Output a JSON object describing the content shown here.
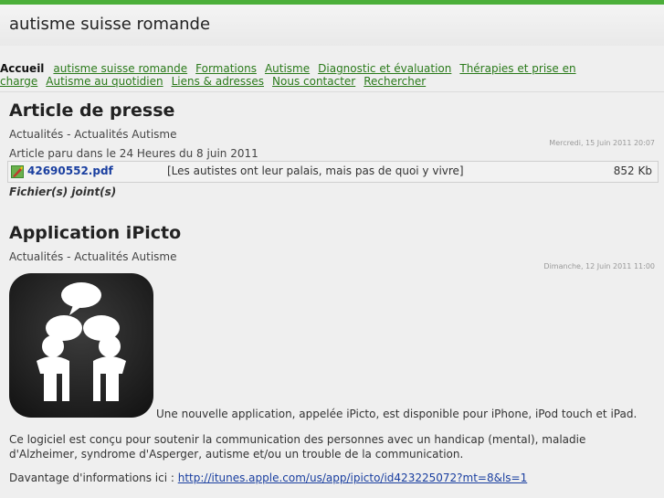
{
  "site": {
    "title": "autisme suisse romande"
  },
  "nav": {
    "items": [
      {
        "label": "Accueil",
        "current": true
      },
      {
        "label": "autisme suisse romande"
      },
      {
        "label": "Formations"
      },
      {
        "label": "Autisme"
      },
      {
        "label": "Diagnostic et évaluation"
      },
      {
        "label": "Thérapies et prise en charge"
      },
      {
        "label": "Autisme au quotidien"
      },
      {
        "label": "Liens & adresses"
      },
      {
        "label": "Nous contacter"
      },
      {
        "label": "Rechercher"
      }
    ]
  },
  "articles": [
    {
      "title": "Article de presse",
      "category": "Actualités - Actualités Autisme",
      "date": "Mercredi, 15 Juin 2011 20:07",
      "text": "Article paru dans le 24 Heures du 8 juin 2011",
      "attachment": {
        "filename": "42690552.pdf",
        "description": "[Les autistes ont leur palais, mais pas de quoi y vivre]",
        "size": "852 Kb",
        "icon": "pdf-file-icon"
      },
      "attachment_label": "Fichier(s) joint(s)"
    },
    {
      "title": "Application iPicto",
      "category": "Actualités - Actualités Autisme",
      "date": "Dimanche, 12 Juin 2011 11:00",
      "image": "ipicto-app-icon",
      "intro": "Une nouvelle application, appelée iPicto, est disponible pour iPhone, iPod touch et iPad.",
      "para2": "Ce logiciel est conçu pour soutenir la communication des personnes avec un handicap (mental), maladie d'Alzheimer, syndrome d'Asperger, autisme et/ou un trouble de la communication.",
      "para3_prefix": "Davantage d'informations ici : ",
      "para3_link": "http://itunes.apple.com/us/app/ipicto/id423225072?mt=8&ls=1"
    }
  ],
  "colors": {
    "accent": "#4caf3a",
    "link": "#2a7a1a",
    "file_link": "#1a3fa0"
  }
}
